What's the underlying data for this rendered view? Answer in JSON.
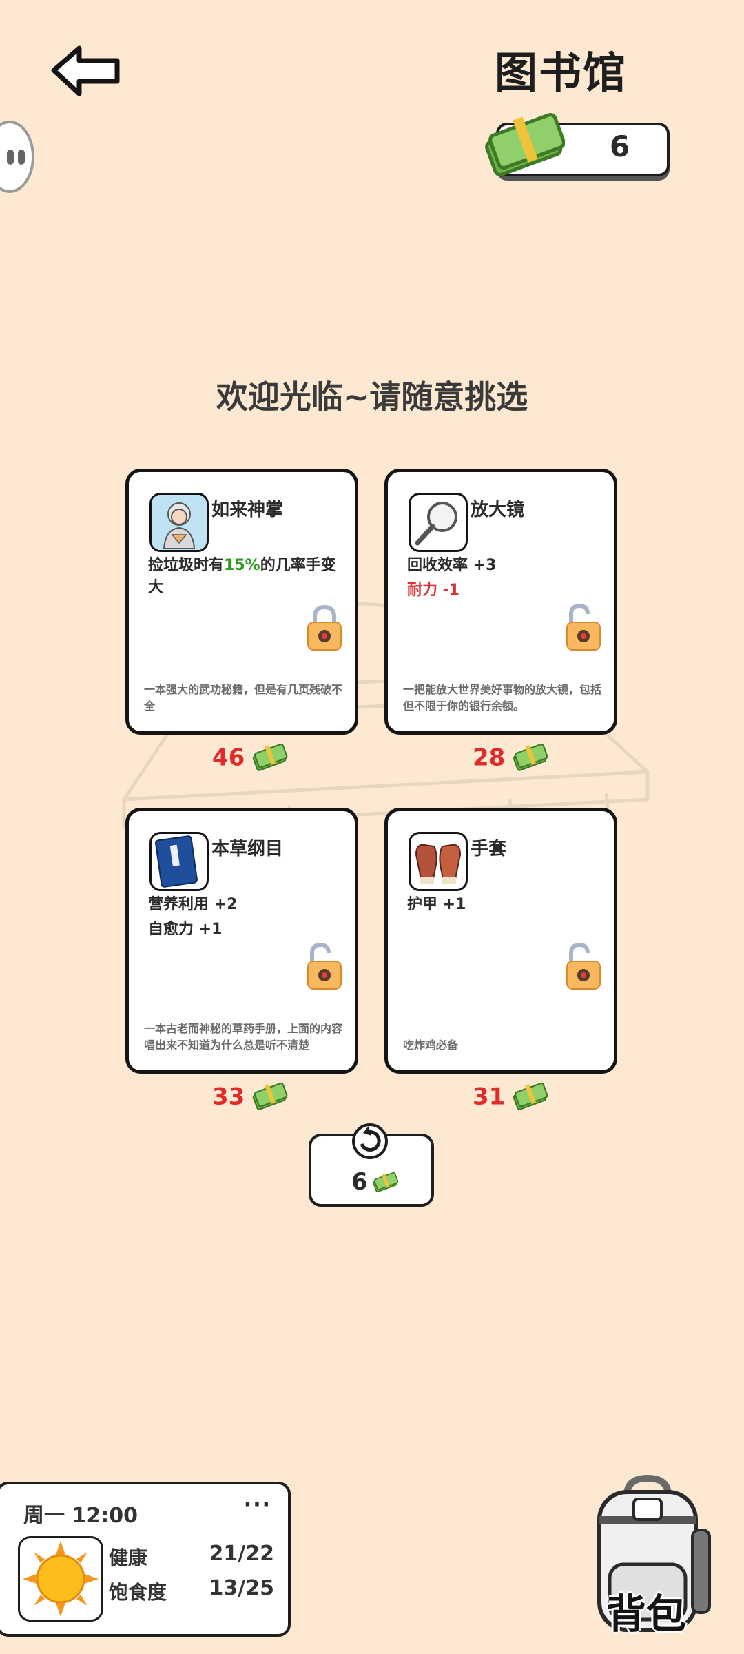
{
  "header": {
    "title": "图书馆",
    "money": "6"
  },
  "welcome": "欢迎光临~请随意挑选",
  "cards": [
    {
      "title": "如来神掌",
      "effect_pre": "捡垃圾时有",
      "effect_highlight": "15%",
      "effect_post": "的几率手变大",
      "description": "一本强大的武功秘籍，但是有几页残破不全",
      "price": "46",
      "icon": "buddha-icon",
      "locked": true
    },
    {
      "title": "放大镜",
      "effects": [
        "回收效率 +3"
      ],
      "negative_effect": "耐力 -1",
      "description": "一把能放大世界美好事物的放大镜，包括但不限于你的银行余额。",
      "price": "28",
      "icon": "magnifier-icon",
      "locked": false
    },
    {
      "title": "本草纲目",
      "effects": [
        "营养利用 +2",
        "自愈力 +1"
      ],
      "description": "一本古老而神秘的草药手册，上面的内容唱出来不知道为什么总是听不清楚",
      "price": "33",
      "icon": "book-icon",
      "locked": false
    },
    {
      "title": "手套",
      "effects": [
        "护甲 +1"
      ],
      "description": "吃炸鸡必备",
      "price": "31",
      "icon": "gloves-icon",
      "locked": false
    }
  ],
  "refresh": {
    "cost": "6"
  },
  "status": {
    "day_time": "周一 12:00",
    "more": "···",
    "health_label": "健康",
    "health_value": "21/22",
    "satiety_label": "饱食度",
    "satiety_value": "13/25",
    "weather_icon": "sun-icon"
  },
  "backpack": {
    "label": "背包"
  },
  "colors": {
    "background": "#fde9d2",
    "price": "#e12a2a",
    "highlight": "#2c9a22",
    "negative": "#e03030"
  }
}
